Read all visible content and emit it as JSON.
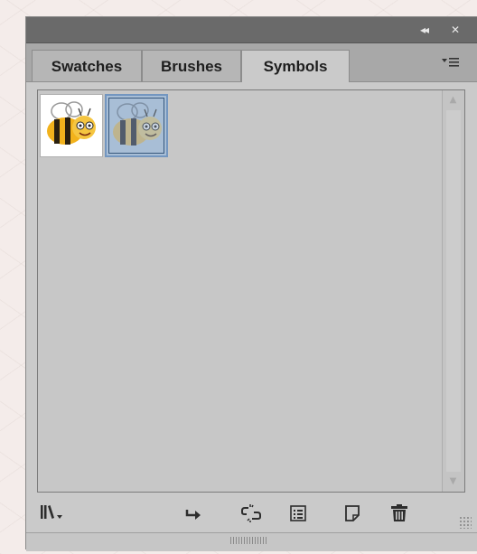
{
  "panel": {
    "title_controls": {
      "collapse_glyph": "◂◂",
      "close_glyph": "✕"
    },
    "tabs": [
      {
        "label": "Swatches",
        "active": false
      },
      {
        "label": "Brushes",
        "active": false
      },
      {
        "label": "Symbols",
        "active": true
      }
    ],
    "menu_icon": "panel-menu-icon",
    "symbols": [
      {
        "name": "bee-symbol-1",
        "selected": false
      },
      {
        "name": "bee-symbol-2",
        "selected": true
      }
    ],
    "toolbar": [
      {
        "icon": "symbol-libraries-menu-icon"
      },
      {
        "icon": "place-symbol-instance-icon"
      },
      {
        "icon": "break-link-icon"
      },
      {
        "icon": "symbol-options-icon"
      },
      {
        "icon": "new-symbol-icon"
      },
      {
        "icon": "delete-symbol-icon"
      }
    ]
  },
  "colors": {
    "panel_bg": "#cacaca",
    "title_bar": "#6a6a6a",
    "selection": "#7396c0",
    "bee_yellow": "#f2b21c",
    "bee_stripe": "#2a2010"
  }
}
